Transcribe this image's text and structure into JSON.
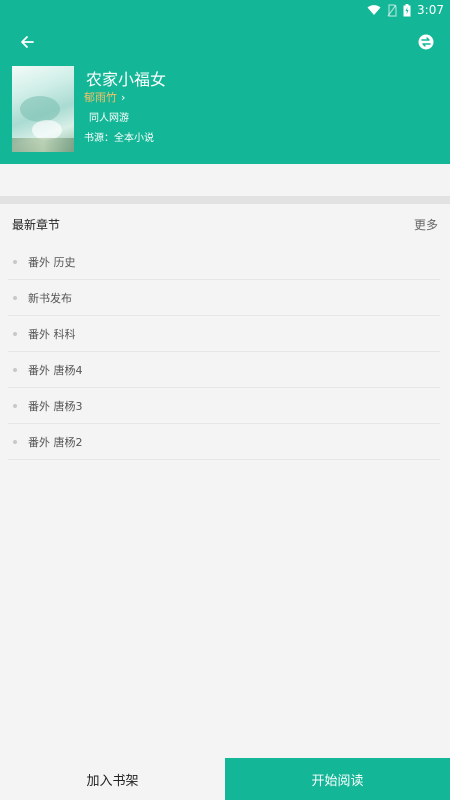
{
  "status_bar": {
    "time": "3:07"
  },
  "book": {
    "title": "农家小福女",
    "author": "郁雨竹",
    "category": "同人网游",
    "source_label": "书源：",
    "source_value": "全本小说"
  },
  "chapters_section": {
    "title": "最新章节",
    "more": "更多",
    "items": [
      {
        "label": "番外 历史"
      },
      {
        "label": "新书发布"
      },
      {
        "label": "番外 科科"
      },
      {
        "label": "番外 唐杨4"
      },
      {
        "label": "番外 唐杨3"
      },
      {
        "label": "番外 唐杨2"
      }
    ]
  },
  "bottom_bar": {
    "add_to_shelf": "加入书架",
    "start_reading": "开始阅读"
  },
  "colors": {
    "accent": "#13b797",
    "author": "#f3c16a",
    "background": "#f4f4f4"
  }
}
